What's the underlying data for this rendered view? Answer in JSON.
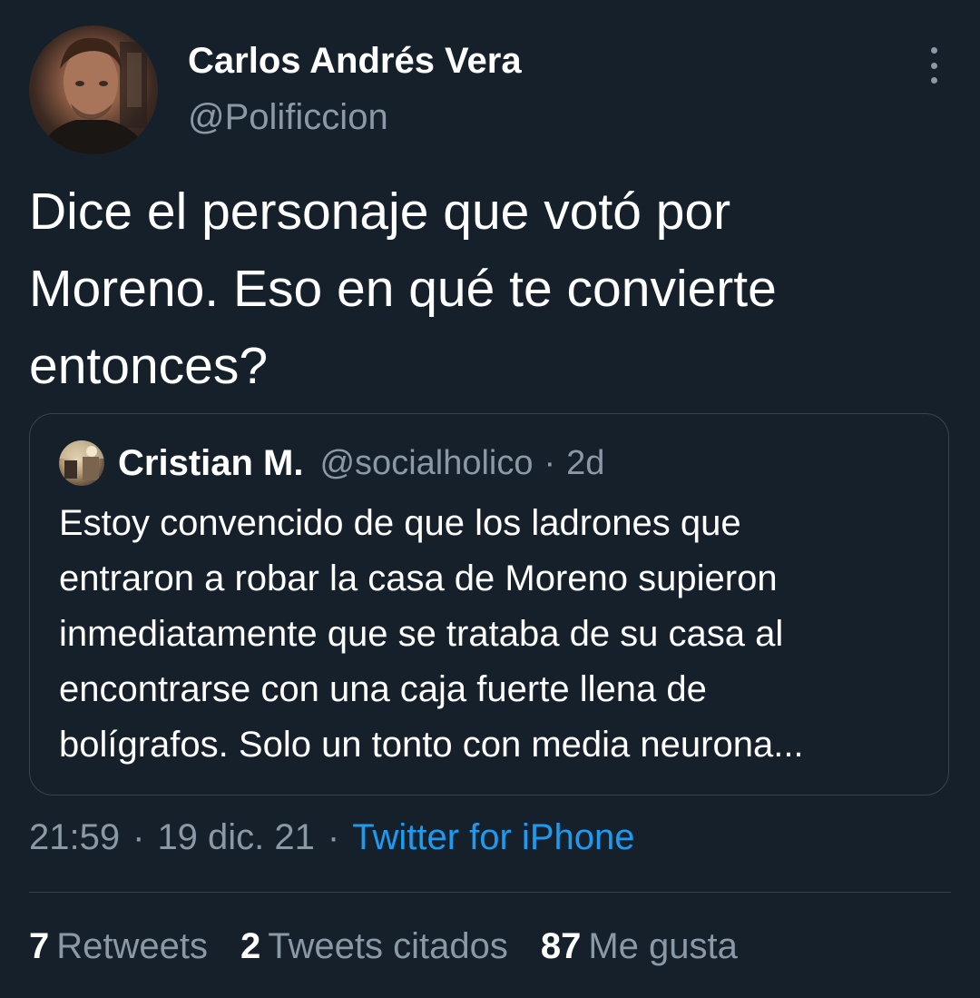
{
  "author": {
    "display_name": "Carlos Andrés Vera",
    "handle": "@Polificcion"
  },
  "tweet": {
    "lines": [
      "Dice el personaje que votó por",
      "Moreno. Eso en qué te convierte",
      "entonces?"
    ]
  },
  "quoted": {
    "display_name": "Cristian M.",
    "handle": "@socialholico",
    "dot": "·",
    "time": "2d",
    "lines": [
      "Estoy convencido de que los ladrones que",
      "entraron a robar la casa de Moreno supieron",
      "inmediatamente que se trataba de su casa al",
      "encontrarse con una caja fuerte llena de",
      "bolígrafos. Solo un tonto con media neurona..."
    ]
  },
  "meta": {
    "time": "21:59",
    "sep": "·",
    "date": "19 dic. 21",
    "source": "Twitter for iPhone"
  },
  "stats": [
    {
      "count": "7",
      "label": "Retweets"
    },
    {
      "count": "2",
      "label": "Tweets citados"
    },
    {
      "count": "87",
      "label": "Me gusta"
    }
  ],
  "colors": {
    "background": "#15202b",
    "text": "#ffffff",
    "secondary": "#8b98a5",
    "accent": "#1d9bf0",
    "border": "#38444d"
  },
  "icons": {
    "more": "more-vertical-icon"
  }
}
